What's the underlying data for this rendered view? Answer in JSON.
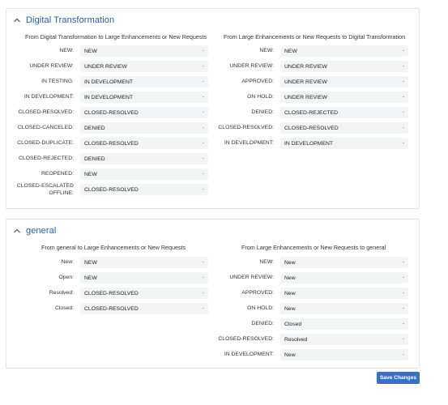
{
  "sections": [
    {
      "title": "Digital Transformation",
      "left": {
        "heading": "From Digital Transformation to Large Enhancements or New Requests",
        "rows": [
          {
            "label": "NEW:",
            "value": "NEW"
          },
          {
            "label": "UNDER REVIEW:",
            "value": "UNDER REVIEW"
          },
          {
            "label": "IN TESTING:",
            "value": "IN DEVELOPMENT"
          },
          {
            "label": "IN DEVELOPMENT:",
            "value": "IN DEVELOPMENT"
          },
          {
            "label": "CLOSED-RESOLVED:",
            "value": "CLOSED-RESOLVED"
          },
          {
            "label": "CLOSED-CANCELED:",
            "value": "DENIED"
          },
          {
            "label": "CLOSED-DUPLICATE:",
            "value": "CLOSED-RESOLVED"
          },
          {
            "label": "CLOSED-REJECTED:",
            "value": "DENIED"
          },
          {
            "label": "REOPENED:",
            "value": "NEW"
          },
          {
            "label": "CLOSED-ESCALATED OFFLINE:",
            "value": "CLOSED-RESOLVED"
          }
        ]
      },
      "right": {
        "heading": "From Large Enhancements or New Requests to Digital Transformation",
        "rows": [
          {
            "label": "NEW:",
            "value": "NEW"
          },
          {
            "label": "UNDER REVIEW:",
            "value": "UNDER REVIEW"
          },
          {
            "label": "APPROVED:",
            "value": "UNDER REVIEW"
          },
          {
            "label": "ON HOLD:",
            "value": "UNDER REVIEW"
          },
          {
            "label": "DENIED:",
            "value": "CLOSED-REJECTED"
          },
          {
            "label": "CLOSED-RESOLVED:",
            "value": "CLOSED-RESOLVED"
          },
          {
            "label": "IN DEVELOPMENT:",
            "value": "IN DEVELOPMENT"
          }
        ]
      }
    },
    {
      "title": "general",
      "left": {
        "heading": "From general to Large Enhancements or New Requests",
        "rows": [
          {
            "label": "New:",
            "value": "NEW"
          },
          {
            "label": "Open:",
            "value": "NEW"
          },
          {
            "label": "Resolved:",
            "value": "CLOSED-RESOLVED"
          },
          {
            "label": "Closed:",
            "value": "CLOSED-RESOLVED"
          }
        ]
      },
      "right": {
        "heading": "From Large Enhancements or New Requests to general",
        "rows": [
          {
            "label": "NEW:",
            "value": "New"
          },
          {
            "label": "UNDER REVIEW:",
            "value": "New"
          },
          {
            "label": "APPROVED:",
            "value": "New"
          },
          {
            "label": "ON HOLD:",
            "value": "New"
          },
          {
            "label": "DENIED:",
            "value": "Closed"
          },
          {
            "label": "CLOSED-RESOLVED:",
            "value": "Resolved"
          },
          {
            "label": "IN DEVELOPMENT:",
            "value": "New"
          }
        ]
      }
    }
  ],
  "dropdown_arrow": "-",
  "save_label": "Save Changes",
  "colors": {
    "accent": "#2c5aa0",
    "button": "#3b6fc4",
    "select_bg": "#f3f4f6"
  }
}
